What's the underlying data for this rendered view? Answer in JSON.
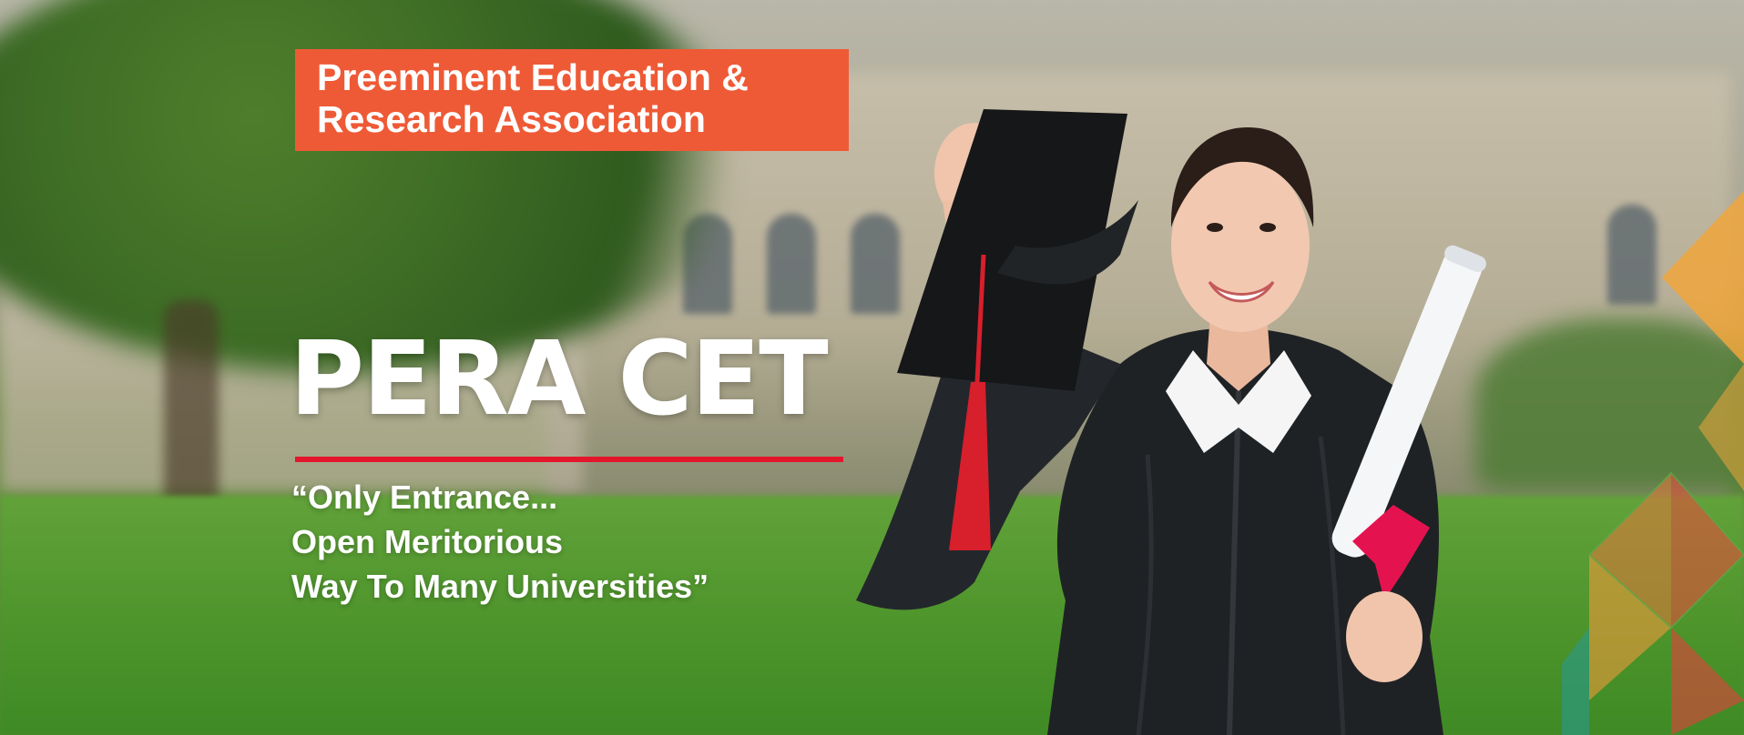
{
  "banner": {
    "organization": "Preeminent Education & Research Association",
    "headline": "PERA CET",
    "tagline": [
      "“Only Entrance...",
      "Open Meritorious",
      "Way To Many Universities”"
    ]
  },
  "colors": {
    "tag_background": "#ee5a36",
    "underline": "#e3162b",
    "text": "#ffffff"
  },
  "graphics": {
    "photo": "graduate-with-cap-and-diploma",
    "decoration": "geometric-triangles"
  }
}
